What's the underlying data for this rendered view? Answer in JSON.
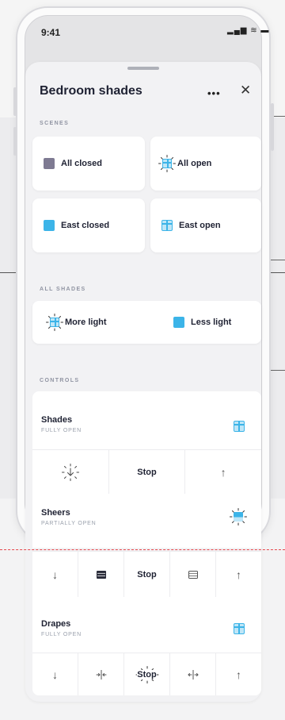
{
  "status_bar": {
    "time": "9:41",
    "icons": "▂▄▆ ≋ ▬"
  },
  "sheet": {
    "title": "Bedroom shades",
    "more_label": "•••",
    "close_label": "✕"
  },
  "sections": {
    "scenes": "SCENES",
    "all_shades": "ALL SHADES",
    "controls": "CONTROLS"
  },
  "scenes": [
    {
      "label": "All closed",
      "icon": "shade-closed-grey-icon"
    },
    {
      "label": "All open",
      "icon": "shade-open-sun-icon"
    },
    {
      "label": "East closed",
      "icon": "shade-closed-blue-icon"
    },
    {
      "label": "East open",
      "icon": "shade-open-blue-icon"
    }
  ],
  "all_shades": {
    "more_light": "More light",
    "less_light": "Less light"
  },
  "controls": [
    {
      "name": "Shades",
      "state": "FULLY OPEN",
      "buttons": [
        "",
        "Stop",
        "↑"
      ]
    },
    {
      "name": "Sheers",
      "state": "PARTIALLY OPEN",
      "buttons": [
        "↓",
        "",
        "Stop",
        "",
        "↑"
      ]
    },
    {
      "name": "Drapes",
      "state": "FULLY OPEN",
      "buttons": [
        "↓",
        "→|←",
        "Stop",
        "←|→",
        "↑"
      ]
    }
  ],
  "colors": {
    "accent_blue": "#3cb4e8",
    "closed_grey": "#7e7a92",
    "annotation_red": "#e5484d"
  }
}
